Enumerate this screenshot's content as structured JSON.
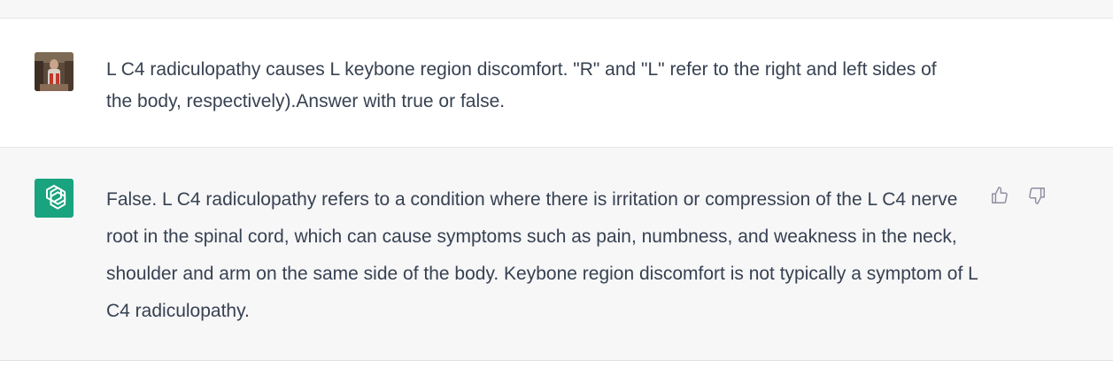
{
  "conversation": {
    "user_message": {
      "avatar_icon": "user-photo-avatar",
      "text": "L C4 radiculopathy causes L keybone region discomfort. \"R\" and \"L\" refer to the right and left sides of the body, respectively).Answer with true or false."
    },
    "assistant_message": {
      "avatar_icon": "chatgpt-logo-icon",
      "text": "False. L C4 radiculopathy refers to a condition where there is irritation or compression of the L C4 nerve root in the spinal cord, which can cause symptoms such as pain, numbness, and weakness in the neck, shoulder and arm on the same side of the body. Keybone region discomfort is not typically a symptom of L C4 radiculopathy.",
      "feedback": {
        "thumbs_up_icon": "thumbs-up-icon",
        "thumbs_down_icon": "thumbs-down-icon"
      }
    }
  },
  "colors": {
    "assistant_avatar_bg": "#19a37f",
    "text": "#374151",
    "assistant_row_bg": "#f7f7f8"
  }
}
